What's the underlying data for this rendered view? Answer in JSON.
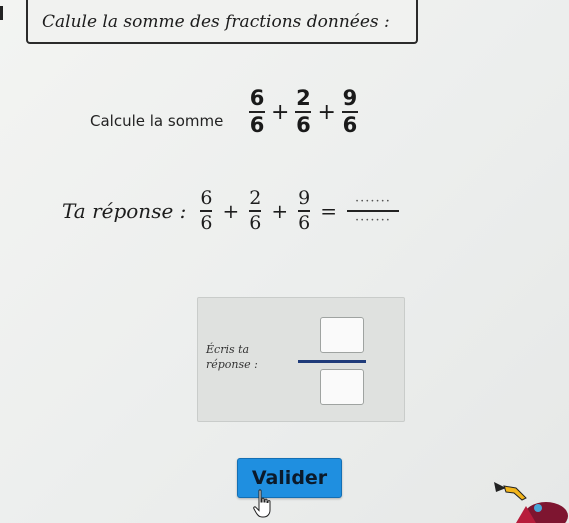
{
  "header": {
    "title": "Calule la somme des fractions données :"
  },
  "question": {
    "label": "Calcule la somme",
    "fractions": [
      {
        "num": "6",
        "den": "6"
      },
      {
        "num": "2",
        "den": "6"
      },
      {
        "num": "9",
        "den": "6"
      }
    ],
    "plus": "+"
  },
  "answer": {
    "label": "Ta réponse :",
    "equals": "=",
    "placeholder_num": "·······",
    "placeholder_den": "·······"
  },
  "input": {
    "label_line1": "Écris ta",
    "label_line2": "réponse :",
    "numerator": "",
    "denominator": ""
  },
  "validate": {
    "label": "Valider"
  },
  "colors": {
    "button": "#1f8fe0",
    "fraction_bar": "#1f3b7a"
  },
  "icons": {
    "cursor": "hand-pointer-icon",
    "mascot": "mascot-icon"
  }
}
